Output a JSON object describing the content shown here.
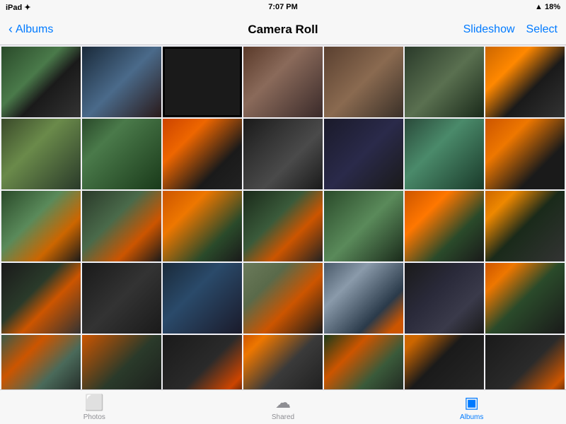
{
  "status_bar": {
    "left": "iPad ✦",
    "time": "7:07 PM",
    "right_signal": "▲ 18%"
  },
  "nav": {
    "back_label": "Albums",
    "title": "Camera Roll",
    "slideshow_label": "Slideshow",
    "select_label": "Select"
  },
  "tabs": [
    {
      "id": "photos",
      "label": "Photos",
      "icon": "⬜",
      "active": false
    },
    {
      "id": "shared",
      "label": "Shared",
      "icon": "☁",
      "active": false
    },
    {
      "id": "albums",
      "label": "Albums",
      "icon": "▣",
      "active": true
    }
  ],
  "grid": {
    "rows": [
      [
        "p1",
        "p2",
        "p3",
        "p4",
        "p5",
        "p6",
        "p7"
      ],
      [
        "p8",
        "p9",
        "p10",
        "p11",
        "p12",
        "p13",
        "p14"
      ],
      [
        "p15",
        "p16",
        "p17",
        "p18",
        "p19",
        "p20",
        "p21"
      ],
      [
        "p22",
        "p23",
        "p24",
        "p25",
        "p26",
        "p27",
        "p28"
      ],
      [
        "p29",
        "p30",
        "p31",
        "p32",
        "p33",
        "p34",
        "p35"
      ]
    ],
    "selected_index": "2"
  }
}
